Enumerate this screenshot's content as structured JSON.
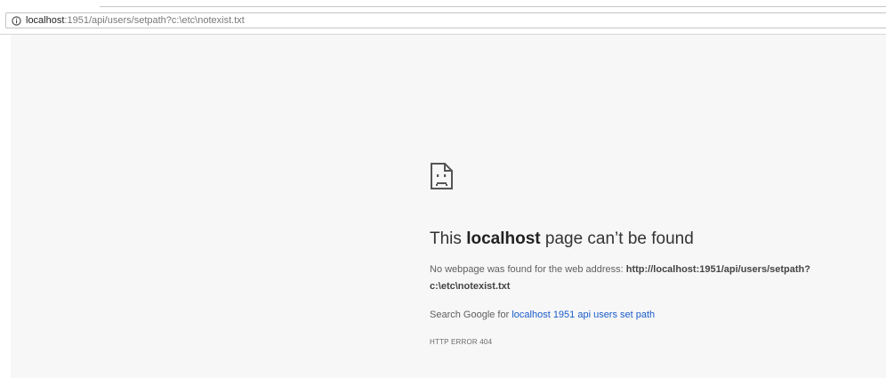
{
  "address_bar": {
    "host": "localhost",
    "path": ":1951/api/users/setpath?c:\\etc\\notexist.txt",
    "info_icon": "info-icon"
  },
  "error": {
    "icon": "sad-page-icon",
    "title_prefix": "This ",
    "title_host": "localhost",
    "title_suffix": " page can’t be found",
    "desc_prefix": "No webpage was found for the web address: ",
    "desc_url": "http://localhost:1951/api/users/setpath?c:\\etc\\notexist.txt",
    "search_prefix": "Search Google for ",
    "search_link": "localhost 1951 api users set path",
    "code": "HTTP ERROR 404"
  },
  "colors": {
    "page_bg": "#f7f7f7",
    "link": "#1a5cc9",
    "text": "#5f5f5f"
  }
}
